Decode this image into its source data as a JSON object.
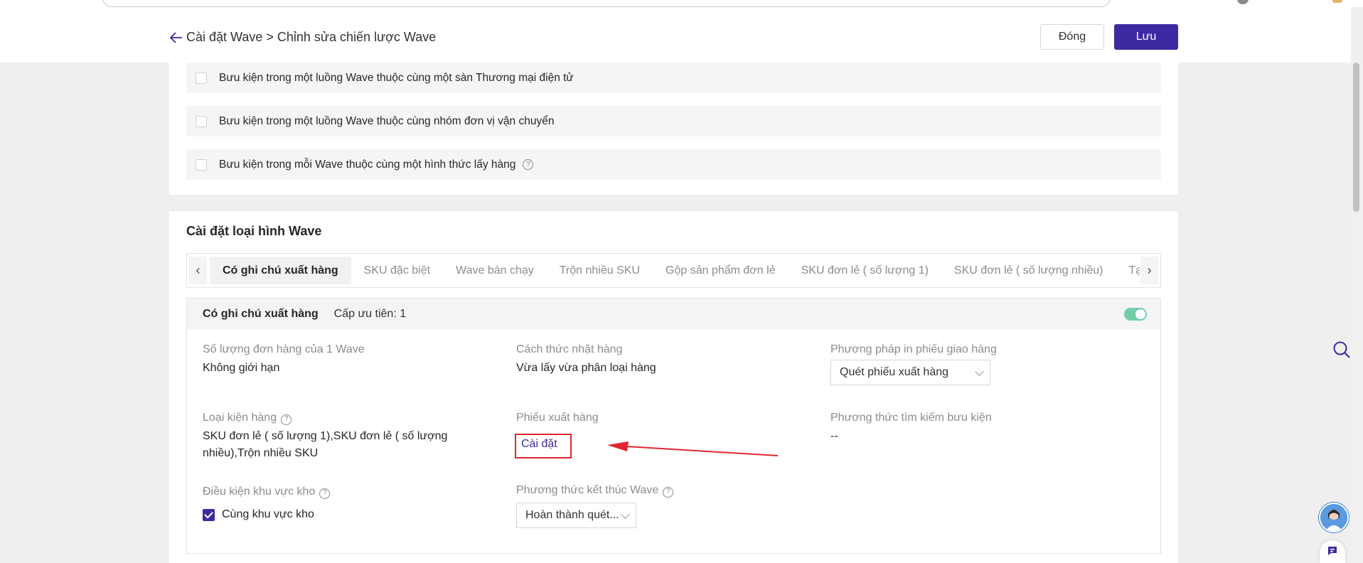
{
  "header": {
    "breadcrumb": "Cài đặt Wave > Chỉnh sửa chiến lược Wave",
    "close_label": "Đóng",
    "save_label": "Lưu"
  },
  "conditions": [
    {
      "label": "Bưu kiện trong một luồng Wave thuộc cùng một sàn Thương mại điện tử",
      "checked": false,
      "has_help": false
    },
    {
      "label": "Bưu kiện trong một luồng Wave thuộc cùng nhóm đơn vị vận chuyển",
      "checked": false,
      "has_help": false
    },
    {
      "label": "Bưu kiện trong mỗi Wave thuộc cùng một hình thức lấy hàng",
      "checked": false,
      "has_help": true
    }
  ],
  "wave_type": {
    "section_title": "Cài đặt loại hình Wave",
    "tabs": [
      {
        "label": "Có ghi chú xuất hàng",
        "active": true
      },
      {
        "label": "SKU đặc biệt",
        "active": false
      },
      {
        "label": "Wave bán chạy",
        "active": false
      },
      {
        "label": "Trộn nhiều SKU",
        "active": false
      },
      {
        "label": "Gộp sản phẩm đơn lẻ",
        "active": false
      },
      {
        "label": "SKU đơn lẻ ( số lượng 1)",
        "active": false
      },
      {
        "label": "SKU đơn lẻ ( số lượng nhiều)",
        "active": false
      },
      {
        "label": "Tạo thủ công",
        "active": false
      }
    ],
    "panel": {
      "name": "Có ghi chú xuất hàng",
      "priority": "Cấp ưu tiên: 1",
      "enabled": true,
      "fields": {
        "order_qty_label": "Số lượng đơn hàng của 1 Wave",
        "order_qty_value": "Không giới hạn",
        "picking_method_label": "Cách thức nhặt hàng",
        "picking_method_value": "Vừa lấy vừa phân loại hàng",
        "print_method_label": "Phương pháp in phiếu giao hàng",
        "print_method_value": "Quét phiếu xuất hàng",
        "package_type_label": "Loại kiện hàng",
        "package_type_value": "SKU đơn lẻ ( số lượng 1),SKU đơn lẻ ( số lượng nhiều),Trộn nhiều SKU",
        "slip_label": "Phiếu xuất hàng",
        "slip_link": "Cài đặt",
        "search_method_label": "Phương thức tìm kiếm bưu kiện",
        "search_method_value": "--",
        "zone_label": "Điều kiện khu vực kho",
        "zone_option": "Cùng khu vực kho",
        "zone_checked": true,
        "end_method_label": "Phương thức kết thúc Wave",
        "end_method_value": "Hoàn thành quét..."
      }
    }
  },
  "colors": {
    "primary": "#3d2aa3",
    "toggle_on": "#6fcfa8",
    "annotation_red": "#e0262f"
  },
  "icons": {
    "back": "arrow-left-icon",
    "help": "question-circle-icon",
    "search": "search-icon",
    "chat": "chat-icon"
  }
}
